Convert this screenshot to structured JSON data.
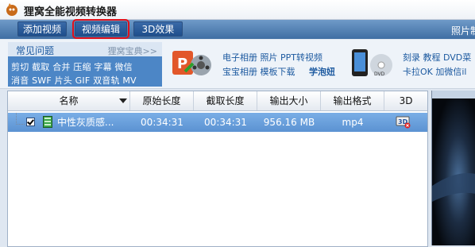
{
  "app": {
    "title": "狸窝全能视频转换器"
  },
  "toolbar": {
    "buttons": [
      "添加视频",
      "视频编辑",
      "3D效果"
    ],
    "right_label": "照片制"
  },
  "banner": {
    "faq_title": "常见问题",
    "faq_more": "狸窝宝典>>",
    "faq_line1": "剪切 截取 合并 压缩 字幕 微信",
    "faq_line2": "消音 SWF 片头 GIF 双音轨 MV",
    "promo1_line1": "电子相册  照片 PPT转视频",
    "promo1_line2a": "宝宝相册  模板下载",
    "promo1_line2b": "学泡妞",
    "promo2_line1": "刻录 教程 DVD菜",
    "promo2_line2": "卡拉OK 加微信il"
  },
  "table": {
    "headers": [
      "名称",
      "原始长度",
      "截取长度",
      "输出大小",
      "输出格式",
      "3D"
    ],
    "rows": [
      {
        "name": "中性灰质感...",
        "original_length": "00:34:31",
        "clip_length": "00:34:31",
        "output_size": "956.16 MB",
        "output_format": "mp4",
        "checked": true
      }
    ]
  }
}
